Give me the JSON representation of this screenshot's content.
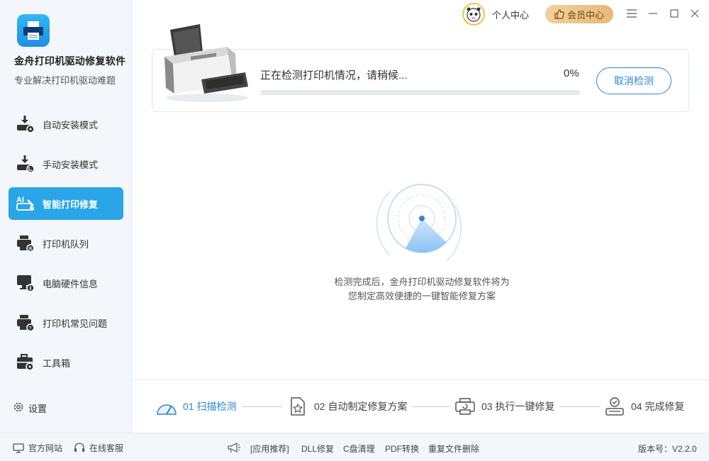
{
  "app": {
    "title": "金舟打印机驱动修复软件",
    "subtitle": "专业解决打印机驱动难题"
  },
  "sidebar": {
    "items": [
      {
        "label": "自动安装模式",
        "icon": "auto-install-icon",
        "active": false
      },
      {
        "label": "手动安装模式",
        "icon": "manual-install-icon",
        "active": false
      },
      {
        "label": "智能打印修复",
        "icon": "ai-repair-icon",
        "active": true
      },
      {
        "label": "打印机队列",
        "icon": "printer-queue-icon",
        "active": false
      },
      {
        "label": "电脑硬件信息",
        "icon": "hardware-info-icon",
        "active": false
      },
      {
        "label": "打印机常见问题",
        "icon": "printer-faq-icon",
        "active": false
      },
      {
        "label": "工具箱",
        "icon": "toolbox-icon",
        "active": false
      }
    ],
    "settings_label": "设置"
  },
  "header": {
    "user_label": "个人中心",
    "vip_label": "会员中心"
  },
  "detection": {
    "status": "正在检测打印机情况，请稍候...",
    "percent_text": "0%",
    "progress": 0,
    "cancel_label": "取消检测"
  },
  "description": {
    "line1": "检测完成后，金舟打印机驱动修复软件将为",
    "line2": "您制定高效便捷的一键智能修复方案"
  },
  "steps": [
    {
      "label": "01 扫描检测",
      "active": true
    },
    {
      "label": "02 自动制定修复方案",
      "active": false
    },
    {
      "label": "03 执行一键修复",
      "active": false
    },
    {
      "label": "04 完成修复",
      "active": false
    }
  ],
  "footer": {
    "website": "官方网站",
    "support": "在线客服",
    "recommend": "[应用推荐]",
    "links": [
      "DLL修复",
      "C盘清理",
      "PDF转换",
      "重复文件删除"
    ],
    "version": "版本号：V2.2.0"
  },
  "colors": {
    "accent": "#2aa5e8",
    "primary_blue": "#2b86d6",
    "vip_gold": "#e9b877"
  }
}
